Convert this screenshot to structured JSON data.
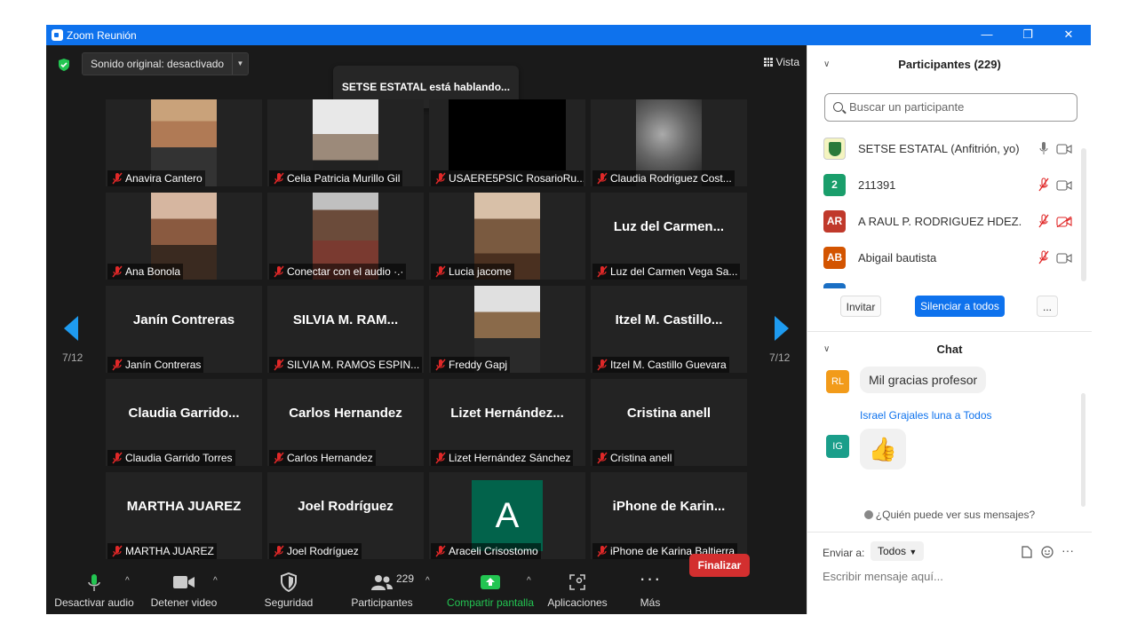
{
  "window": {
    "title": "Zoom Reunión",
    "minimize": "—",
    "maximize": "❐",
    "close": "✕"
  },
  "meeting": {
    "sound_option": "Sonido original: desactivado",
    "speaking": "SETSE ESTATAL está hablando...",
    "view_label": "Vista",
    "page_left": "7/12",
    "page_right": "7/12"
  },
  "tiles": [
    {
      "label": "Anavira Cantero",
      "big": "",
      "video": "v1"
    },
    {
      "label": "Celia Patricia Murillo Gil",
      "big": "",
      "video": "v2"
    },
    {
      "label": "USAERE5PSIC RosarioRu...",
      "big": "",
      "video": "v3"
    },
    {
      "label": "Claudia Rodriguez Cost...",
      "big": "",
      "video": "v4"
    },
    {
      "label": "Ana Bonola",
      "big": "",
      "video": "v5"
    },
    {
      "label": "Conectar con el audio ·.·",
      "big": "",
      "video": "v6"
    },
    {
      "label": "Lucia jacome",
      "big": "",
      "video": "v7"
    },
    {
      "label": "Luz del Carmen Vega Sa...",
      "big": "Luz del Carmen...",
      "video": ""
    },
    {
      "label": "Janín Contreras",
      "big": "Janín Contreras",
      "video": ""
    },
    {
      "label": "SILVIA M. RAMOS ESPIN...",
      "big": "SILVIA M. RAM...",
      "video": ""
    },
    {
      "label": "Freddy Gapj",
      "big": "",
      "video": "v8"
    },
    {
      "label": "Itzel M. Castillo Guevara",
      "big": "Itzel M. Castillo...",
      "video": ""
    },
    {
      "label": "Claudia Garrido Torres",
      "big": "Claudia Garrido...",
      "video": ""
    },
    {
      "label": "Carlos Hernandez",
      "big": "Carlos Hernandez",
      "video": ""
    },
    {
      "label": "Lizet Hernández Sánchez",
      "big": "Lizet Hernández...",
      "video": ""
    },
    {
      "label": "Cristina anell",
      "big": "Cristina anell",
      "video": ""
    },
    {
      "label": "MARTHA JUAREZ",
      "big": "MARTHA JUAREZ",
      "video": ""
    },
    {
      "label": "Joel Rodríguez",
      "big": "Joel Rodríguez",
      "video": ""
    },
    {
      "label": "Araceli Crisostomo",
      "big": "",
      "video": "avatar",
      "avatar_letter": "A"
    },
    {
      "label": "iPhone de Karina Baltierra",
      "big": "iPhone de Karin...",
      "video": ""
    }
  ],
  "toolbar": {
    "mute": "Desactivar audio",
    "video": "Detener video",
    "security": "Seguridad",
    "participants": "Participantes",
    "participants_count": "229",
    "share": "Compartir pantalla",
    "apps": "Aplicaciones",
    "more": "Más",
    "end": "Finalizar"
  },
  "participants_panel": {
    "header": "Participantes (229)",
    "search_placeholder": "Buscar un participante",
    "list": [
      {
        "initials": "",
        "name": "SETSE ESTATAL (Anfitrión, yo)",
        "color": "#f4f4c0"
      },
      {
        "initials": "2",
        "name": "211391",
        "color": "#1a9e6b"
      },
      {
        "initials": "AR",
        "name": "A RAUL P. RODRIGUEZ HDEZ.",
        "color": "#c0392b"
      },
      {
        "initials": "AB",
        "name": "Abigail bautista",
        "color": "#d35400"
      }
    ],
    "invite": "Invitar",
    "mute_all": "Silenciar a todos",
    "more": "..."
  },
  "chat_panel": {
    "header": "Chat",
    "msg1_initials": "RL",
    "msg1_text": "Mil gracias profesor",
    "msg2_sender": "Israel Grajales luna a Todos",
    "msg2_initials": "IG",
    "msg2_emoji": "👍",
    "who_can_see": "¿Quién puede ver sus mensajes?",
    "send_to_label": "Enviar a:",
    "send_to_value": "Todos",
    "input_placeholder": "Escribir mensaje aquí...",
    "more": "···"
  }
}
